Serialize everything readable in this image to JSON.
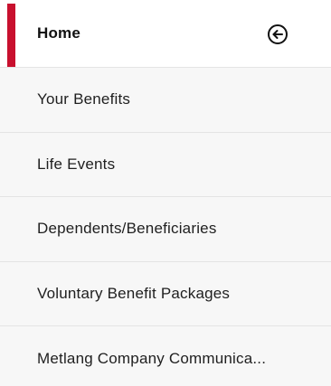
{
  "nav": {
    "accent_color": "#c8102e",
    "collapse_icon": "arrow-left-circle-icon",
    "items": [
      {
        "label": "Home",
        "active": true
      },
      {
        "label": "Your Benefits",
        "active": false
      },
      {
        "label": "Life Events",
        "active": false
      },
      {
        "label": "Dependents/Beneficiaries",
        "active": false
      },
      {
        "label": "Voluntary Benefit Packages",
        "active": false
      },
      {
        "label": "Metlang Company Communica...",
        "active": false
      }
    ]
  }
}
